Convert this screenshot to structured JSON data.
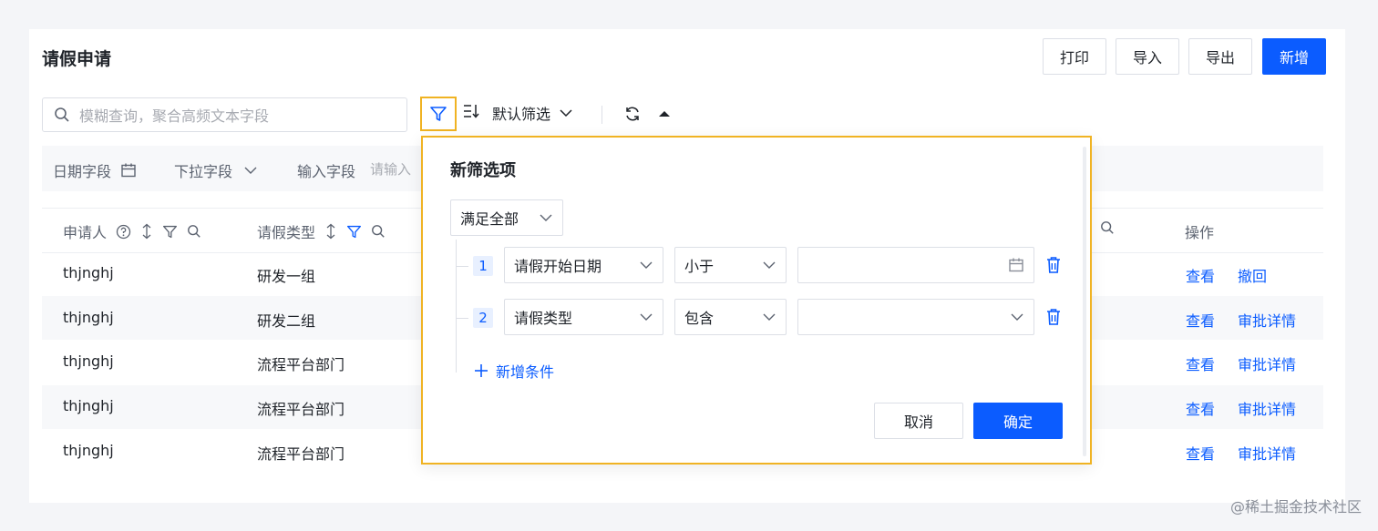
{
  "page": {
    "title": "请假申请"
  },
  "actions": {
    "print": "打印",
    "import": "导入",
    "export": "导出",
    "add": "新增"
  },
  "search": {
    "placeholder": "模糊查询，聚合高频文本字段"
  },
  "toolbar": {
    "default_filter": "默认筛选"
  },
  "filter_fields": {
    "date": "日期字段",
    "dropdown": "下拉字段",
    "input": "输入字段",
    "input_placeholder": "请输入"
  },
  "columns": {
    "applicant": "申请人",
    "leave_type": "请假类型",
    "actions": "操作"
  },
  "rows": [
    {
      "applicant": "thjnghj",
      "leave_type": "研发一组",
      "view": "查看",
      "action": "撤回"
    },
    {
      "applicant": "thjnghj",
      "leave_type": "研发二组",
      "view": "查看",
      "action": "审批详情"
    },
    {
      "applicant": "thjnghj",
      "leave_type": "流程平台部门",
      "view": "查看",
      "action": "审批详情"
    },
    {
      "applicant": "thjnghj",
      "leave_type": "流程平台部门",
      "view": "查看",
      "action": "审批详情"
    },
    {
      "applicant": "thjnghj",
      "leave_type": "流程平台部门",
      "view": "查看",
      "action": "审批详情"
    }
  ],
  "popup": {
    "title": "新筛选项",
    "match_mode": "满足全部",
    "conditions": [
      {
        "index": "1",
        "field": "请假开始日期",
        "operator": "小于",
        "value": ""
      },
      {
        "index": "2",
        "field": "请假类型",
        "operator": "包含",
        "value": ""
      }
    ],
    "add_condition": "新增条件",
    "cancel": "取消",
    "confirm": "确定"
  },
  "watermark": "@稀土掘金技术社区",
  "colors": {
    "accent": "#0b5cff",
    "highlight": "#f0b323"
  }
}
